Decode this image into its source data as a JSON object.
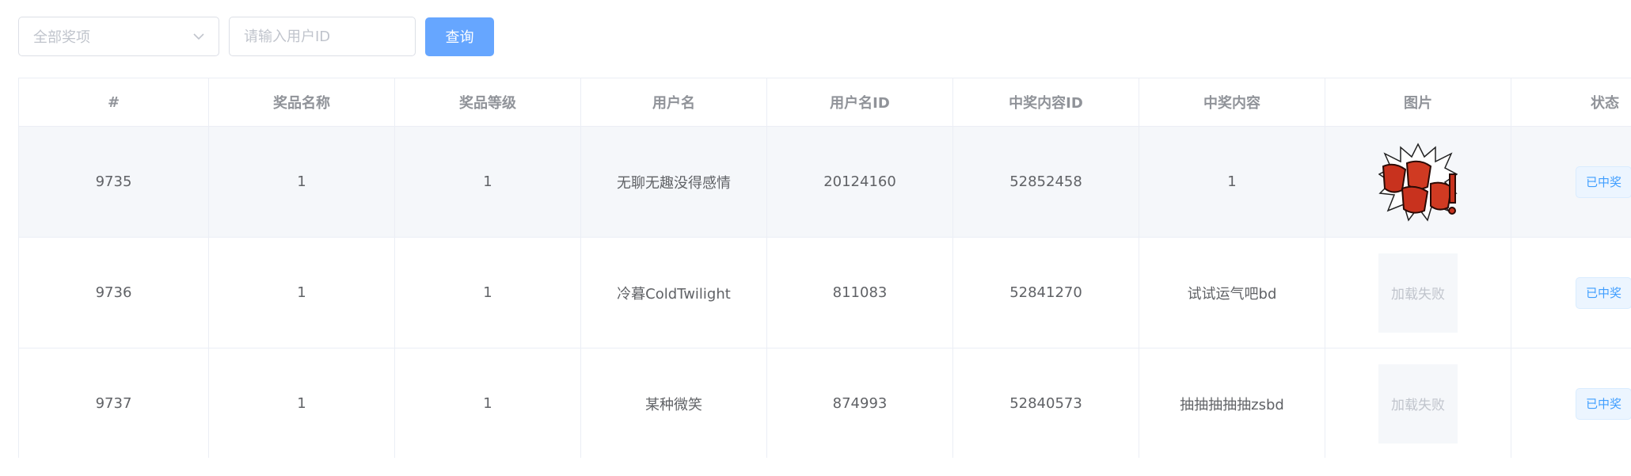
{
  "filters": {
    "award_select_placeholder": "全部奖项",
    "user_id_placeholder": "请输入用户ID",
    "query_button_label": "查询"
  },
  "table": {
    "columns": [
      "#",
      "奖品名称",
      "奖品等级",
      "用户名",
      "用户名ID",
      "中奖内容ID",
      "中奖内容",
      "图片",
      "状态"
    ],
    "rows": [
      {
        "id": "9735",
        "prize_name": "1",
        "prize_level": "1",
        "username": "无聊无趣没得感情",
        "user_id": "20124160",
        "content_id": "52852458",
        "content": "1",
        "image_status": "loaded",
        "status": "已中奖"
      },
      {
        "id": "9736",
        "prize_name": "1",
        "prize_level": "1",
        "username": "冷暮ColdTwilight",
        "user_id": "811083",
        "content_id": "52841270",
        "content": "试试运气吧bd",
        "image_status": "加载失败",
        "status": "已中奖"
      },
      {
        "id": "9737",
        "prize_name": "1",
        "prize_level": "1",
        "username": "某种微笑",
        "user_id": "874993",
        "content_id": "52840573",
        "content": "抽抽抽抽抽zsbd",
        "image_status": "加载失败",
        "status": "已中奖"
      }
    ]
  },
  "icons": {
    "select_arrow": "chevron-down-icon"
  },
  "colors": {
    "primary_button": "#66a6ff",
    "tag_text": "#409eff",
    "tag_bg": "#ecf5ff",
    "hover_row": "#f5f7fa"
  }
}
